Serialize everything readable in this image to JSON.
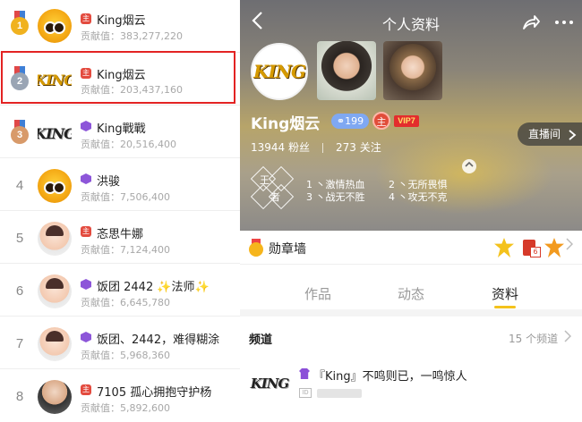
{
  "leaderboard": {
    "contrib_label": "贡献值：",
    "rows": [
      {
        "rank": "1",
        "name": "King烟云",
        "contribution": "383,277,220",
        "medal_color": "#f0b21f",
        "tag": "主"
      },
      {
        "rank": "2",
        "name": "King烟云",
        "contribution": "203,437,160",
        "medal_color": "#9aa5b4",
        "tag": "主"
      },
      {
        "rank": "3",
        "name": "King戰戰",
        "contribution": "20,516,400",
        "medal_color": "#d89a6a",
        "tag": ""
      },
      {
        "rank": "4",
        "name": "洪骏",
        "contribution": "7,506,400",
        "tag": ""
      },
      {
        "rank": "5",
        "name": "忞思牛娜",
        "contribution": "7,124,400",
        "tag": "主"
      },
      {
        "rank": "6",
        "name": "饭团 2442 ✨法师✨",
        "contribution": "6,645,780",
        "tag": ""
      },
      {
        "rank": "7",
        "name": "饭团、2442，难得糊涂",
        "contribution": "5,968,360",
        "tag": ""
      },
      {
        "rank": "8",
        "name": "7105 孤心拥抱守护杨",
        "contribution": "5,892,600",
        "tag": "主"
      }
    ]
  },
  "profile": {
    "nav_title": "个人资料",
    "avatar_text": "KING",
    "user_name": "King烟云",
    "level": "199",
    "king_badge": "主",
    "vip_badge": "VIP7",
    "fans": "13944 粉丝",
    "following": "273 关注",
    "live_room": "直播间",
    "title_chars": [
      "王",
      "者"
    ],
    "motto": [
      "1 丶激情热血",
      "2 丶无所畏惧",
      "3 丶战无不胜",
      "4 丶攻无不克"
    ],
    "medal_wall_label": "勋章墙",
    "tabs": [
      "作品",
      "动态",
      "资料"
    ],
    "active_tab": "资料",
    "channel_title": "频道",
    "channel_count": "15 个频道",
    "channel": {
      "thumb_text": "KING",
      "name": "『King』不鸣则已，一鸣惊人",
      "id_label": "ID"
    }
  },
  "colors": {
    "highlight_border": "#e32323",
    "tab_underline": "#f4c21c",
    "level_pill": "#7fa8f2",
    "tag_red": "#e34b3f",
    "tag_purple": "#8d56d9"
  },
  "icons": {
    "back": "chevron-left-icon",
    "share": "share-icon",
    "more": "more-dots-icon",
    "chevron": "chevron-right-icon"
  }
}
